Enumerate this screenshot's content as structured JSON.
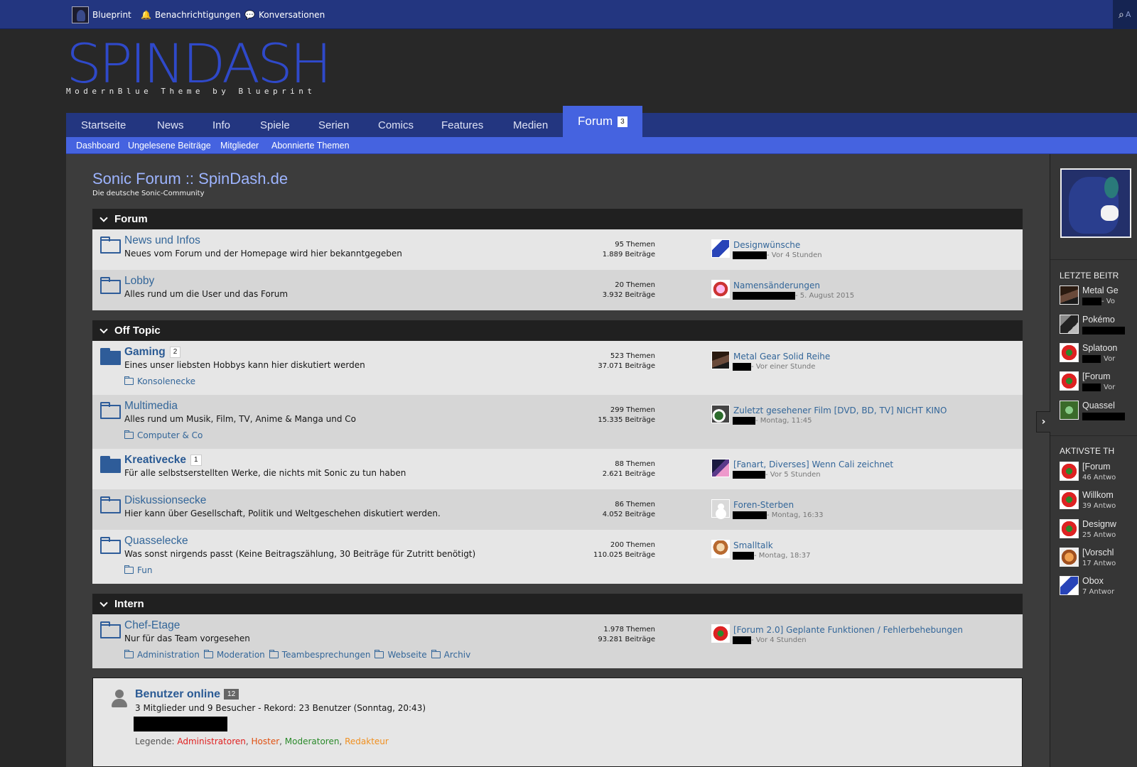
{
  "topbar": {
    "user": "Blueprint",
    "notifications": "Benachrichtigungen",
    "conversations": "Konversationen",
    "search_partial": "A"
  },
  "logo": {
    "word": "SPINDASH",
    "tagline": "ModernBlue Theme by Blueprint"
  },
  "mainnav": {
    "tabs": [
      "Startseite",
      "News",
      "Info",
      "Spiele",
      "Serien",
      "Comics",
      "Features",
      "Medien"
    ],
    "active": "Forum",
    "active_badge": "3"
  },
  "subnav": [
    "Dashboard",
    "Ungelesene Beiträge",
    "Mitglieder",
    "Abonnierte Themen"
  ],
  "page": {
    "title": "Sonic Forum :: SpinDash.de",
    "subtitle": "Die deutsche Sonic-Community"
  },
  "categories": [
    {
      "title": "Forum",
      "boards": [
        {
          "name": "News und Infos",
          "desc": "Neues vom Forum und der Homepage wird hier bekanntgegeben",
          "topics": "95 Themen",
          "posts": "1.889 Beiträge",
          "last_title": "Designwünsche",
          "last_time": "- Vor 4 Stunden"
        },
        {
          "name": "Lobby",
          "desc": "Alles rund um die User und das Forum",
          "topics": "20 Themen",
          "posts": "3.932 Beiträge",
          "last_title": "Namensänderungen",
          "last_time": "- 5. August 2015"
        }
      ]
    },
    {
      "title": "Off Topic",
      "boards": [
        {
          "name": "Gaming",
          "badge": "2",
          "desc": "Eines unser liebsten Hobbys kann hier diskutiert werden",
          "subforums": [
            "Konsolenecke"
          ],
          "topics": "523 Themen",
          "posts": "37.071 Beiträge",
          "last_title": "Metal Gear Solid Reihe",
          "last_time": "- Vor einer Stunde"
        },
        {
          "name": "Multimedia",
          "desc": "Alles rund um Musik, Film, TV, Anime & Manga und Co",
          "subforums": [
            "Computer & Co"
          ],
          "topics": "299 Themen",
          "posts": "15.335 Beiträge",
          "last_title": "Zuletzt gesehener Film [DVD, BD, TV] NICHT KINO",
          "last_time": "- Montag, 11:45"
        },
        {
          "name": "Kreativecke",
          "badge": "1",
          "desc": "Für alle selbstserstellten Werke, die nichts mit Sonic zu tun haben",
          "topics": "88 Themen",
          "posts": "2.621 Beiträge",
          "last_title": "[Fanart, Diverses] Wenn Cali zeichnet",
          "last_time": "- Vor 5 Stunden"
        },
        {
          "name": "Diskussionsecke",
          "desc": "Hier kann über Gesellschaft, Politik und Weltgeschehen diskutiert werden.",
          "topics": "86 Themen",
          "posts": "4.052 Beiträge",
          "last_title": "Foren-Sterben",
          "last_time": "- Montag, 16:33"
        },
        {
          "name": "Quasselecke",
          "desc": "Was sonst nirgends passt (Keine Beitragszählung, 30 Beiträge für Zutritt benötigt)",
          "subforums": [
            "Fun"
          ],
          "topics": "200 Themen",
          "posts": "110.025 Beiträge",
          "last_title": "Smalltalk",
          "last_time": "- Montag, 18:37"
        }
      ]
    },
    {
      "title": "Intern",
      "boards": [
        {
          "name": "Chef-Etage",
          "desc": "Nur für das Team vorgesehen",
          "subforums": [
            "Administration",
            "Moderation",
            "Teambesprechungen",
            "Webseite",
            "Archiv"
          ],
          "topics": "1.978 Themen",
          "posts": "93.281 Beiträge",
          "last_title": "[Forum 2.0] Geplante Funktionen / Fehlerbehebungen",
          "last_time": "- Vor 4 Stunden"
        }
      ]
    }
  ],
  "online": {
    "title": "Benutzer online",
    "count": "12",
    "stats": "3 Mitglieder und 9 Besucher - Rekord: 23 Benutzer (Sonntag, 20:43)",
    "legend_label": "Legende: ",
    "legend": [
      {
        "name": "Administratoren",
        "color": "#e02020"
      },
      {
        "name": "Hoster",
        "color": "#e05010"
      },
      {
        "name": "Moderatoren",
        "color": "#2a8a2a"
      },
      {
        "name": "Redakteur",
        "color": "#f09020"
      }
    ],
    "sep": ", "
  },
  "sidebar": {
    "latest_title": "LETZTE BEITR",
    "latest": [
      {
        "title": "Metal Ge",
        "meta": "- Vo"
      },
      {
        "title": "Pokémo",
        "meta": ""
      },
      {
        "title": "Splatoon",
        "meta": "Vor"
      },
      {
        "title": "[Forum",
        "meta": "Vor"
      },
      {
        "title": "Quassel",
        "meta": ""
      }
    ],
    "active_title": "AKTIVSTE TH",
    "active": [
      {
        "title": "[Forum",
        "meta": "46 Antwo"
      },
      {
        "title": "Willkom",
        "meta": "39 Antwo"
      },
      {
        "title": "Designw",
        "meta": "25 Antwo"
      },
      {
        "title": "[Vorschl",
        "meta": "17 Antwo"
      },
      {
        "title": "Obox",
        "meta": "7 Antwor"
      }
    ]
  }
}
